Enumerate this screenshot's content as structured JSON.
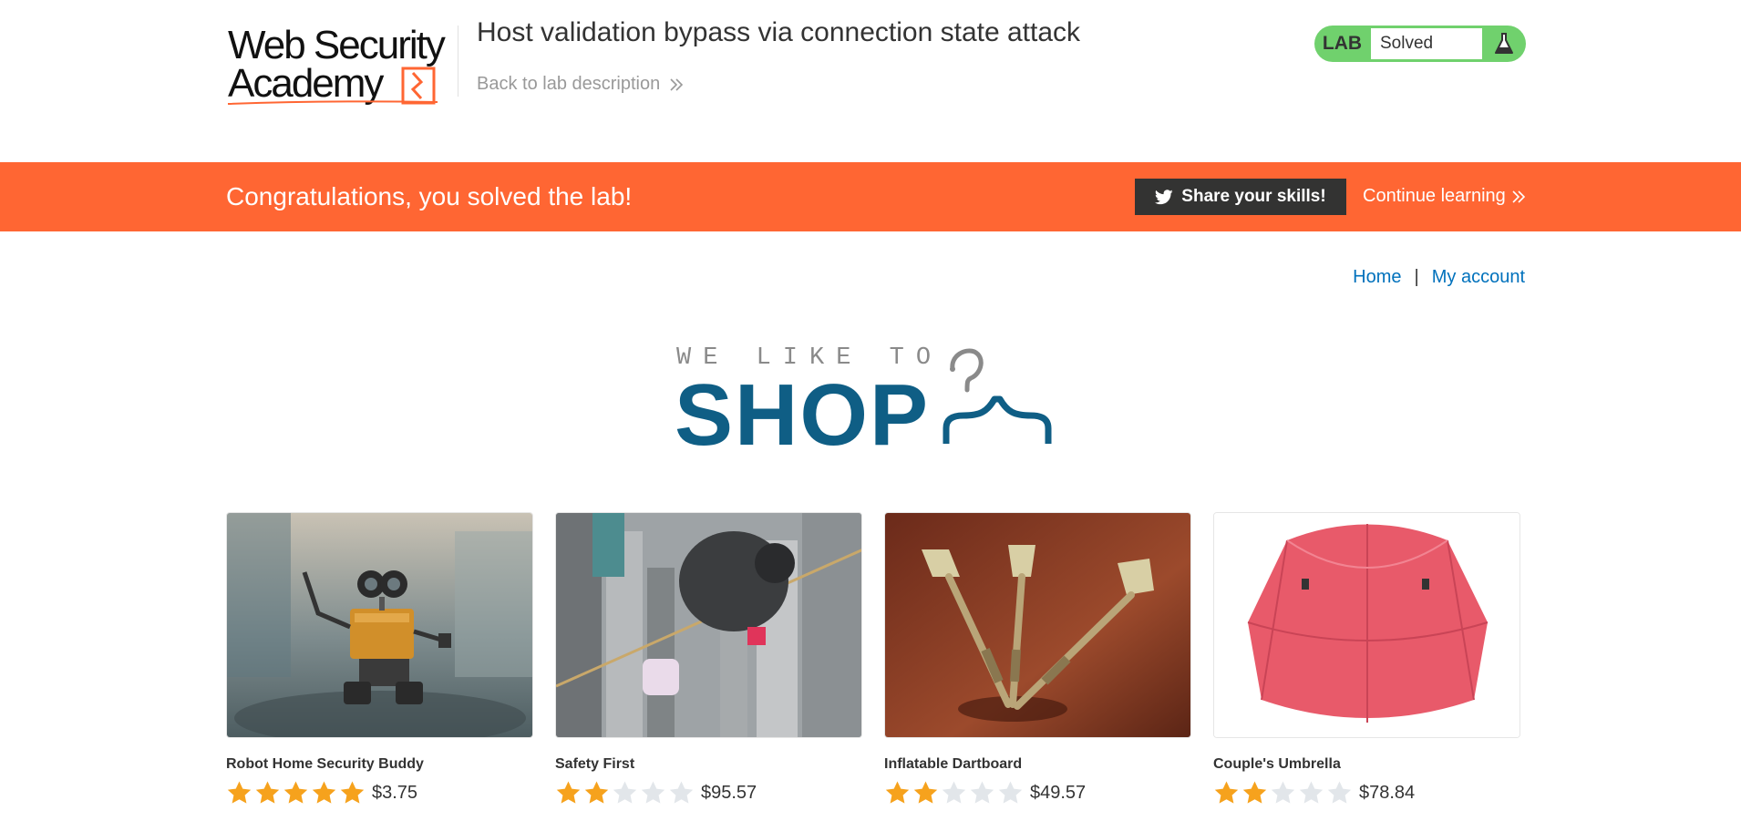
{
  "header": {
    "logo_text": "Web Security Academy",
    "lab_title": "Host validation bypass via connection state attack",
    "back_link_label": "Back to lab description",
    "lab_badge_label": "LAB",
    "lab_status": "Solved"
  },
  "banner": {
    "message": "Congratulations, you solved the lab!",
    "share_label": "Share your skills!",
    "continue_label": "Continue learning"
  },
  "nav": {
    "home_label": "Home",
    "separator": "|",
    "account_label": "My account"
  },
  "shop_logo": {
    "tagline": "WE LIKE TO",
    "name": "SHOP"
  },
  "colors": {
    "brand_orange": "#ff6633",
    "lab_green": "#70d16d",
    "link_blue": "#0071bc",
    "shop_blue": "#0f5e85",
    "star_filled": "#f6a21d",
    "star_empty": "#e2e6ea"
  },
  "products": [
    {
      "name": "Robot Home Security Buddy",
      "rating": 5,
      "max_rating": 5,
      "price": "$3.75",
      "image_icon": "robot-toy-image"
    },
    {
      "name": "Safety First",
      "rating": 2,
      "max_rating": 5,
      "price": "$95.57",
      "image_icon": "tightrope-walker-image"
    },
    {
      "name": "Inflatable Dartboard",
      "rating": 2,
      "max_rating": 5,
      "price": "$49.57",
      "image_icon": "darts-image"
    },
    {
      "name": "Couple's Umbrella",
      "rating": 2,
      "max_rating": 5,
      "price": "$78.84",
      "image_icon": "umbrella-image"
    }
  ]
}
